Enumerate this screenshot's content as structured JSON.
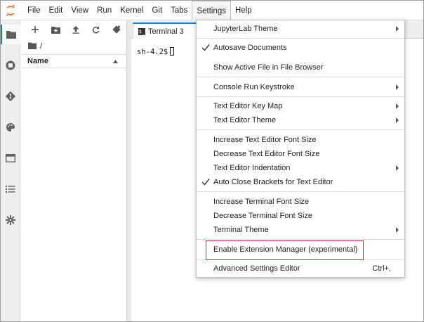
{
  "menubar": {
    "items": [
      "File",
      "Edit",
      "View",
      "Run",
      "Kernel",
      "Git",
      "Tabs",
      "Settings",
      "Help"
    ],
    "active": "Settings"
  },
  "iconbar": {
    "icons": [
      "folder-icon",
      "running-icon",
      "git-icon",
      "palette-icon",
      "tabs-icon",
      "toc-icon",
      "extension-icon"
    ]
  },
  "filebrowser": {
    "path": "/",
    "column_name": "Name"
  },
  "main": {
    "tab_label": "Terminal 3",
    "prompt": "sh-4.2$"
  },
  "settings_menu": {
    "items": [
      {
        "label": "JupyterLab Theme",
        "submenu": true,
        "checked": false
      },
      {
        "label": "Autosave Documents",
        "submenu": false,
        "checked": true
      },
      {
        "label": "Show Active File in File Browser",
        "submenu": false,
        "checked": false
      },
      {
        "label": "Console Run Keystroke",
        "submenu": true,
        "checked": false
      },
      {
        "label": "Text Editor Key Map",
        "submenu": true,
        "checked": false
      },
      {
        "label": "Text Editor Theme",
        "submenu": true,
        "checked": false
      },
      {
        "label": "Increase Text Editor Font Size",
        "submenu": false,
        "checked": false
      },
      {
        "label": "Decrease Text Editor Font Size",
        "submenu": false,
        "checked": false
      },
      {
        "label": "Text Editor Indentation",
        "submenu": true,
        "checked": false
      },
      {
        "label": "Auto Close Brackets for Text Editor",
        "submenu": false,
        "checked": true
      },
      {
        "label": "Increase Terminal Font Size",
        "submenu": false,
        "checked": false
      },
      {
        "label": "Decrease Terminal Font Size",
        "submenu": false,
        "checked": false
      },
      {
        "label": "Terminal Theme",
        "submenu": true,
        "checked": false
      },
      {
        "label": "Enable Extension Manager (experimental)",
        "submenu": false,
        "checked": false,
        "highlighted": true
      },
      {
        "label": "Advanced Settings Editor",
        "submenu": false,
        "checked": false,
        "shortcut": "Ctrl+,"
      }
    ]
  },
  "colors": {
    "accent": "#1976d2",
    "highlight_box": "#d32f2f",
    "jupyter_orange": "#f37726"
  }
}
